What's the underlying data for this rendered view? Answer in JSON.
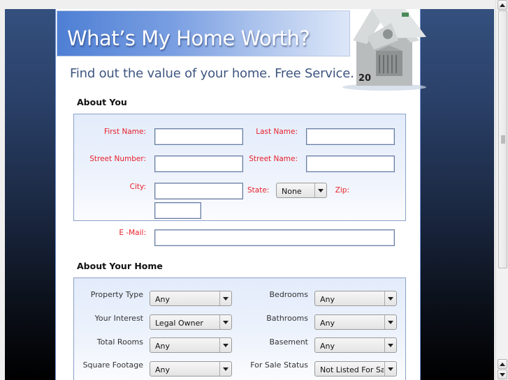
{
  "header": {
    "title": "What’s My Home Worth?",
    "tagline": "Find out the value of your home. Free Service.",
    "illustration": "money-house-image"
  },
  "about_you": {
    "title": "About You",
    "fields": {
      "first_name": {
        "label": "First Name:",
        "value": ""
      },
      "last_name": {
        "label": "Last Name:",
        "value": ""
      },
      "street_number": {
        "label": "Street Number:",
        "value": ""
      },
      "street_name": {
        "label": "Street Name:",
        "value": ""
      },
      "city": {
        "label": "City:",
        "value": ""
      },
      "state": {
        "label": "State:",
        "value": "None"
      },
      "zip": {
        "label": "Zip:",
        "value": ""
      },
      "email": {
        "label": "E -Mail:",
        "value": ""
      }
    }
  },
  "about_home": {
    "title": "About Your Home",
    "fields": {
      "property_type": {
        "label": "Property Type",
        "value": "Any"
      },
      "your_interest": {
        "label": "Your Interest",
        "value": "Legal Owner"
      },
      "total_rooms": {
        "label": "Total Rooms",
        "value": "Any"
      },
      "square_footage": {
        "label": "Square Footage",
        "value": "Any"
      },
      "bedrooms": {
        "label": "Bedrooms",
        "value": "Any"
      },
      "bathrooms": {
        "label": "Bathrooms",
        "value": "Any"
      },
      "basement": {
        "label": "Basement",
        "value": "Any"
      },
      "for_sale_status": {
        "label": "For Sale Status",
        "value": "Not Listed For Sale"
      }
    }
  },
  "colors": {
    "label_red": "#e8202a",
    "banner_blue": "#4e7fd4",
    "tagline": "#3e5680",
    "page_bg_top": "#34507e",
    "page_bg_bottom": "#000000"
  }
}
